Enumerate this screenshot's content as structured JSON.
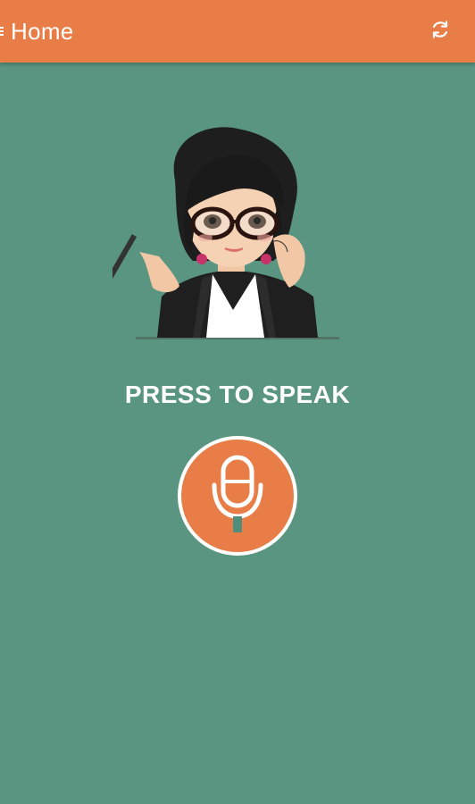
{
  "appbar": {
    "title": "Home",
    "refresh_icon": "refresh-icon",
    "menu_icon": "menu-icon"
  },
  "main": {
    "illustration": "woman-with-glasses-illustration",
    "prompt": "PRESS TO SPEAK",
    "mic_icon": "microphone-icon"
  },
  "colors": {
    "appbar_bg": "#e87d47",
    "page_bg": "#5a9582",
    "accent": "#e87d47",
    "text": "#ffffff"
  }
}
